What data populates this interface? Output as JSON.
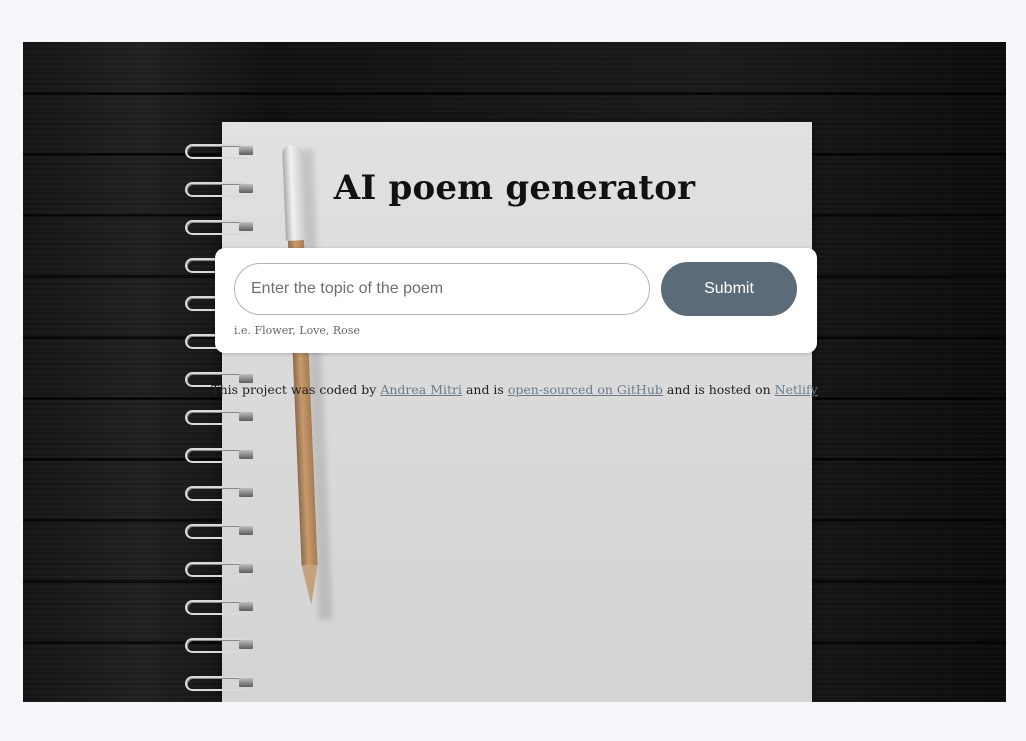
{
  "page": {
    "title": "AI poem generator"
  },
  "form": {
    "input_placeholder": "Enter the topic of the poem",
    "input_value": "",
    "submit_label": "Submit",
    "hint": "i.e. Flower, Love, Rose"
  },
  "footer": {
    "text_1": "This project was coded by ",
    "author_link": "Andrea Mitri",
    "text_2": " and is ",
    "github_link": "open-sourced on GitHub",
    "text_3": " and is hosted on ",
    "netlify_link": "Netlify"
  },
  "colors": {
    "accent": "#5b6b77",
    "link": "#6b7b8c",
    "page_background": "#f6f6fb"
  }
}
